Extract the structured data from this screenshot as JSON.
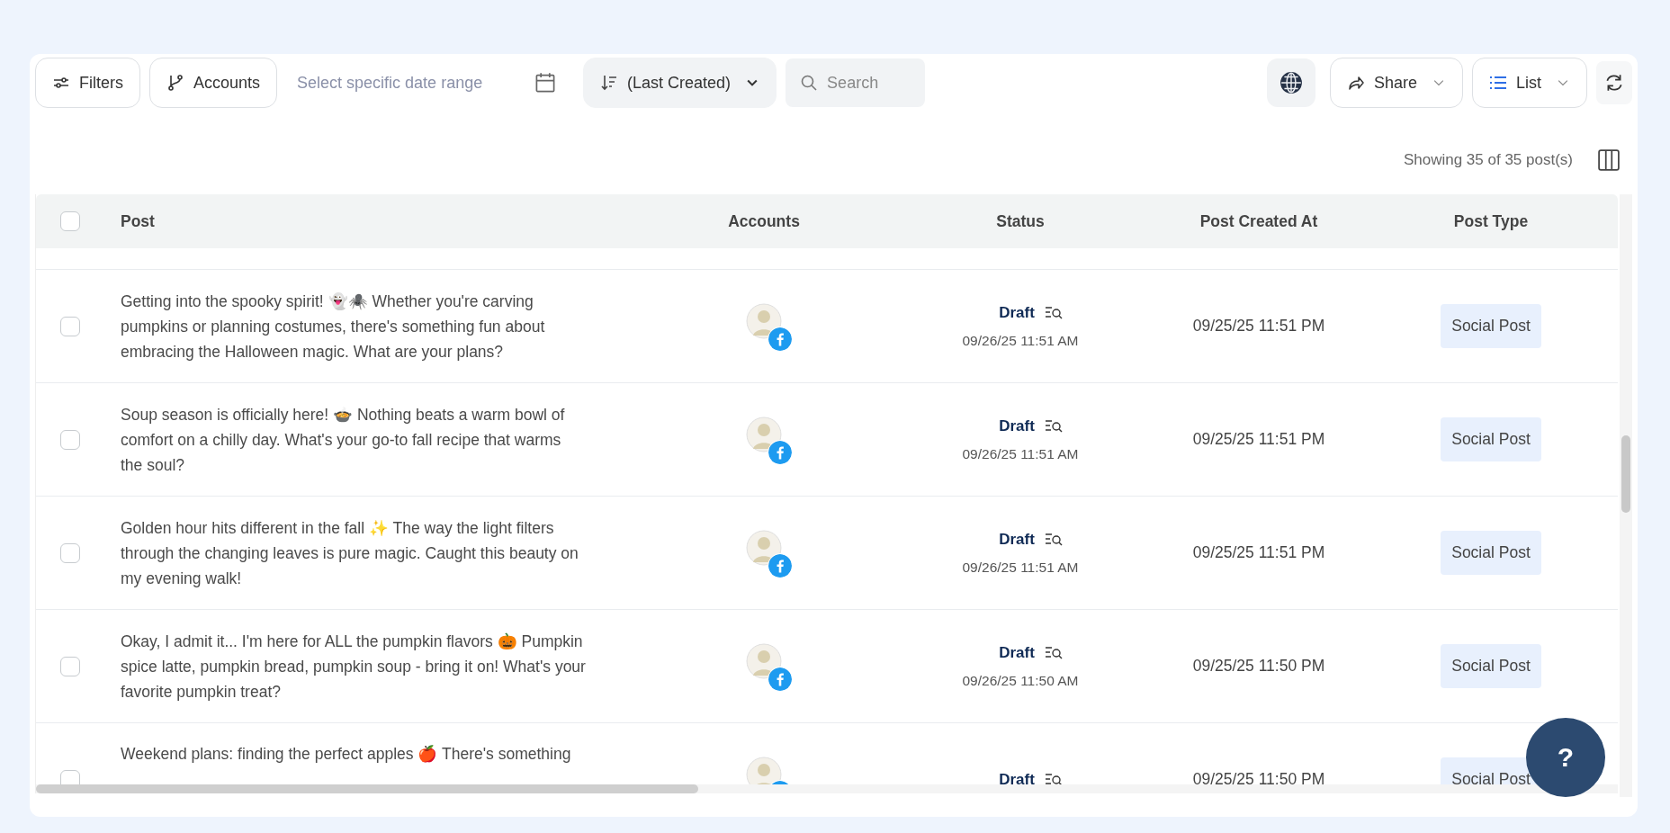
{
  "toolbar": {
    "filters": "Filters",
    "accounts": "Accounts",
    "date_range": {
      "placeholder": "Select specific date range"
    },
    "sort": "(Last Created)",
    "search": {
      "placeholder": "Search"
    },
    "share": "Share",
    "view": "List"
  },
  "summary": "Showing 35 of 35 post(s)",
  "table": {
    "select_all": {
      "checked": false
    },
    "columns": [
      "Post",
      "Accounts",
      "Status",
      "Post Created At",
      "Post Type"
    ],
    "rows": [
      {
        "checked": false,
        "post": "Getting into the spooky spirit! 👻🕷️ Whether you're carving pumpkins or planning costumes, there's something fun about embracing the Halloween magic. What are your plans?",
        "status": "Draft",
        "status_date": "09/26/25 11:51 AM",
        "created_at": "09/25/25 11:51 PM",
        "post_type": "Social Post"
      },
      {
        "checked": false,
        "post": "Soup season is officially here! 🍲 Nothing beats a warm bowl of comfort on a chilly day. What's your go-to fall recipe that warms the soul?",
        "status": "Draft",
        "status_date": "09/26/25 11:51 AM",
        "created_at": "09/25/25 11:51 PM",
        "post_type": "Social Post"
      },
      {
        "checked": false,
        "post": "Golden hour hits different in the fall ✨ The way the light filters through the changing leaves is pure magic. Caught this beauty on my evening walk!",
        "status": "Draft",
        "status_date": "09/26/25 11:51 AM",
        "created_at": "09/25/25 11:51 PM",
        "post_type": "Social Post"
      },
      {
        "checked": false,
        "post": "Okay, I admit it... I'm here for ALL the pumpkin flavors 🎃 Pumpkin spice latte, pumpkin bread, pumpkin soup - bring it on! What's your favorite pumpkin treat?",
        "status": "Draft",
        "status_date": "09/26/25 11:50 AM",
        "created_at": "09/25/25 11:50 PM",
        "post_type": "Social Post"
      },
      {
        "checked": false,
        "post": "Weekend plans: finding the perfect apples 🍎 There's something",
        "status": "Draft",
        "created_at": "09/25/25 11:50 PM",
        "post_type": "Social Post"
      }
    ]
  },
  "help_button": "?"
}
